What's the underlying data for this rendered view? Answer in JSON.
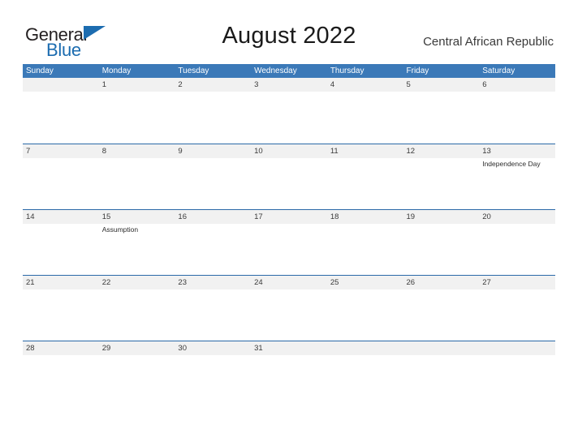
{
  "brand": {
    "name_part1": "General",
    "name_part2": "Blue",
    "flag_icon": "flag-triangle-icon",
    "accent_color": "#1c6cb0"
  },
  "header": {
    "title": "August 2022",
    "region": "Central African Republic"
  },
  "calendar": {
    "month": "August",
    "year": "2022",
    "header_bg_color": "#3b79b8",
    "band_bg_color": "#f1f1f1",
    "separator_color": "#2a69a8",
    "weekdays": [
      "Sunday",
      "Monday",
      "Tuesday",
      "Wednesday",
      "Thursday",
      "Friday",
      "Saturday"
    ],
    "weeks": [
      {
        "days": [
          {
            "num": "",
            "event": ""
          },
          {
            "num": "1",
            "event": ""
          },
          {
            "num": "2",
            "event": ""
          },
          {
            "num": "3",
            "event": ""
          },
          {
            "num": "4",
            "event": ""
          },
          {
            "num": "5",
            "event": ""
          },
          {
            "num": "6",
            "event": ""
          }
        ]
      },
      {
        "days": [
          {
            "num": "7",
            "event": ""
          },
          {
            "num": "8",
            "event": ""
          },
          {
            "num": "9",
            "event": ""
          },
          {
            "num": "10",
            "event": ""
          },
          {
            "num": "11",
            "event": ""
          },
          {
            "num": "12",
            "event": ""
          },
          {
            "num": "13",
            "event": "Independence Day"
          }
        ]
      },
      {
        "days": [
          {
            "num": "14",
            "event": ""
          },
          {
            "num": "15",
            "event": "Assumption"
          },
          {
            "num": "16",
            "event": ""
          },
          {
            "num": "17",
            "event": ""
          },
          {
            "num": "18",
            "event": ""
          },
          {
            "num": "19",
            "event": ""
          },
          {
            "num": "20",
            "event": ""
          }
        ]
      },
      {
        "days": [
          {
            "num": "21",
            "event": ""
          },
          {
            "num": "22",
            "event": ""
          },
          {
            "num": "23",
            "event": ""
          },
          {
            "num": "24",
            "event": ""
          },
          {
            "num": "25",
            "event": ""
          },
          {
            "num": "26",
            "event": ""
          },
          {
            "num": "27",
            "event": ""
          }
        ]
      },
      {
        "days": [
          {
            "num": "28",
            "event": ""
          },
          {
            "num": "29",
            "event": ""
          },
          {
            "num": "30",
            "event": ""
          },
          {
            "num": "31",
            "event": ""
          },
          {
            "num": "",
            "event": ""
          },
          {
            "num": "",
            "event": ""
          },
          {
            "num": "",
            "event": ""
          }
        ]
      }
    ]
  }
}
